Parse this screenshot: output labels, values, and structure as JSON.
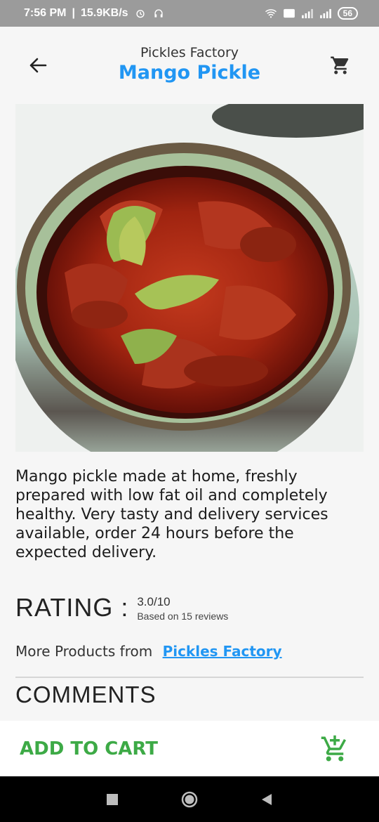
{
  "status_bar": {
    "time": "7:56 PM",
    "speed": "15.9KB/s",
    "battery": "56",
    "icons": [
      "alarm-icon",
      "headset-icon",
      "wifi-icon",
      "volte-icon",
      "signal-icon",
      "signal-4g-icon",
      "battery-icon"
    ]
  },
  "header": {
    "store_name": "Pickles Factory",
    "product_title": "Mango Pickle",
    "back_icon": "arrow-left-icon",
    "cart_icon": "cart-icon"
  },
  "product": {
    "image_alt": "Mango pickle in ceramic bowl",
    "description": "Mango pickle made at home, freshly prepared with low fat oil and completely healthy. Very tasty and delivery services available, order 24 hours before the expected delivery."
  },
  "rating": {
    "label": "RATING :",
    "value": "3.0/10",
    "reviews": "Based on 15 reviews"
  },
  "more_products": {
    "prefix": "More Products from",
    "link": "Pickles Factory"
  },
  "comments": {
    "heading": "COMMENTS"
  },
  "bottom_bar": {
    "add_to_cart": "ADD TO CART",
    "icon": "add-shopping-cart-icon"
  },
  "colors": {
    "accent_blue": "#2196f3",
    "accent_green": "#3daa46",
    "status_bar": "#9b9b9b"
  }
}
